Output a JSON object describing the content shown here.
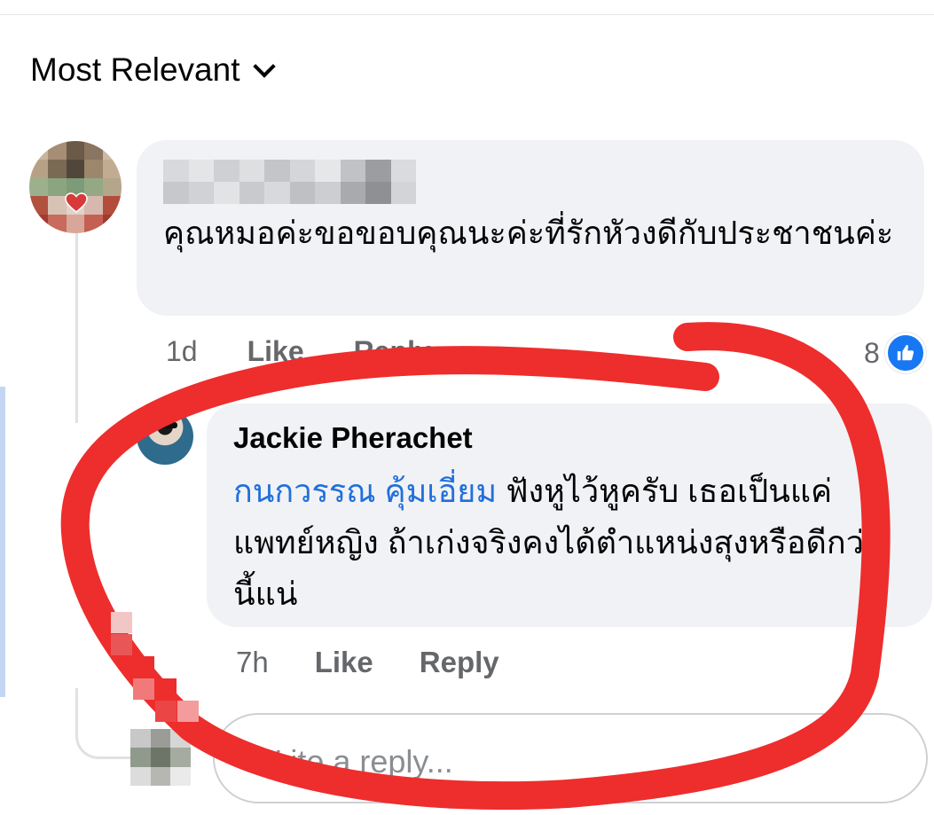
{
  "sort": {
    "label": "Most Relevant",
    "chevron_icon": "chevron-down-icon"
  },
  "comments": [
    {
      "author": "",
      "text": "คุณหมอค่ะขอขอบคุณนะค่ะที่รักหัวงดีกับประชาชนค่ะ",
      "time": "1d",
      "like_label": "Like",
      "reply_label": "Reply",
      "reaction_count": "8",
      "reaction_icon": "like-reaction-icon"
    }
  ],
  "reply": {
    "author": "Jackie Pherachet",
    "mention": "กนกวรรณ คุ้มเอี่ยม",
    "text": " ฟังหูไว้หูครับ เธอเป็นแค่แพทย์หญิง ถ้าเก่งจริงคงได้ตำแหน่งสุงหรือดีกว่านี้แน่",
    "time": "7h",
    "like_label": "Like",
    "reply_label": "Reply"
  },
  "reply_input": {
    "placeholder": "Write a reply..."
  },
  "colors": {
    "bubble": "#f0f2f5",
    "mention": "#216fdb",
    "like_blue": "#1877f2",
    "annotation_red": "#ee2d2d",
    "secondary_text": "#65676b"
  }
}
